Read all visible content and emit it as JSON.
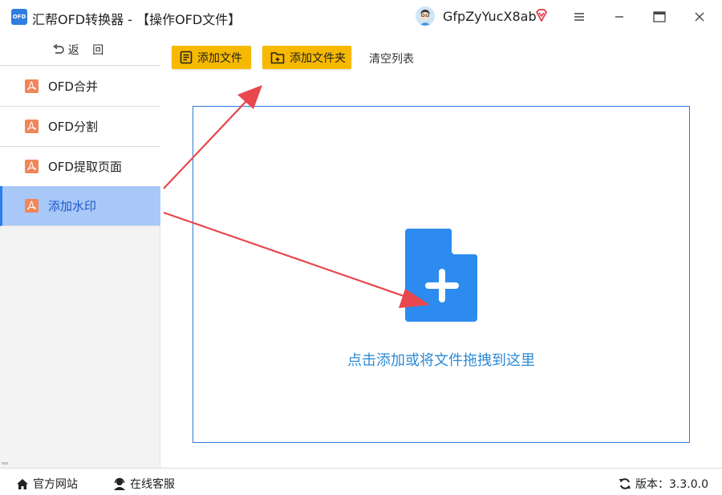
{
  "app": {
    "logo_text": "OFD",
    "title": "汇帮OFD转换器 - 【操作OFD文件】",
    "username": "GfpZyYucX8ab"
  },
  "icons": {
    "logo": "app-logo-icon",
    "avatar": "user-avatar",
    "vip": "vip-diamond-icon",
    "menu": "hamburger-icon",
    "minimize": "minimize-icon",
    "maximize": "maximize-icon",
    "close": "close-icon",
    "back": "undo-arrow-icon",
    "pdf": "pdf-file-icon",
    "file": "file-list-icon",
    "folder": "folder-plus-icon",
    "add_doc": "document-plus-icon",
    "home": "home-icon",
    "service": "headset-icon",
    "refresh": "refresh-icon"
  },
  "colors": {
    "accent": "#2d7cf0",
    "button_yellow": "#f7b900",
    "active_bg": "#a8c8f8",
    "pdf_icon": "#f0855a",
    "doc_icon": "#2d8bf0",
    "hint_text": "#2d8bd6",
    "arrow": "#e8474d"
  },
  "sidebar": {
    "back_label": "返 回",
    "items": [
      {
        "label": "OFD合并",
        "active": false
      },
      {
        "label": "OFD分割",
        "active": false
      },
      {
        "label": "OFD提取页面",
        "active": false
      },
      {
        "label": "添加水印",
        "active": true
      }
    ]
  },
  "toolbar": {
    "add_file": "添加文件",
    "add_folder": "添加文件夹",
    "clear_list": "清空列表"
  },
  "dropzone": {
    "hint": "点击添加或将文件拖拽到这里"
  },
  "statusbar": {
    "website": "官方网站",
    "service": "在线客服",
    "version": "版本：3.3.0.0"
  }
}
